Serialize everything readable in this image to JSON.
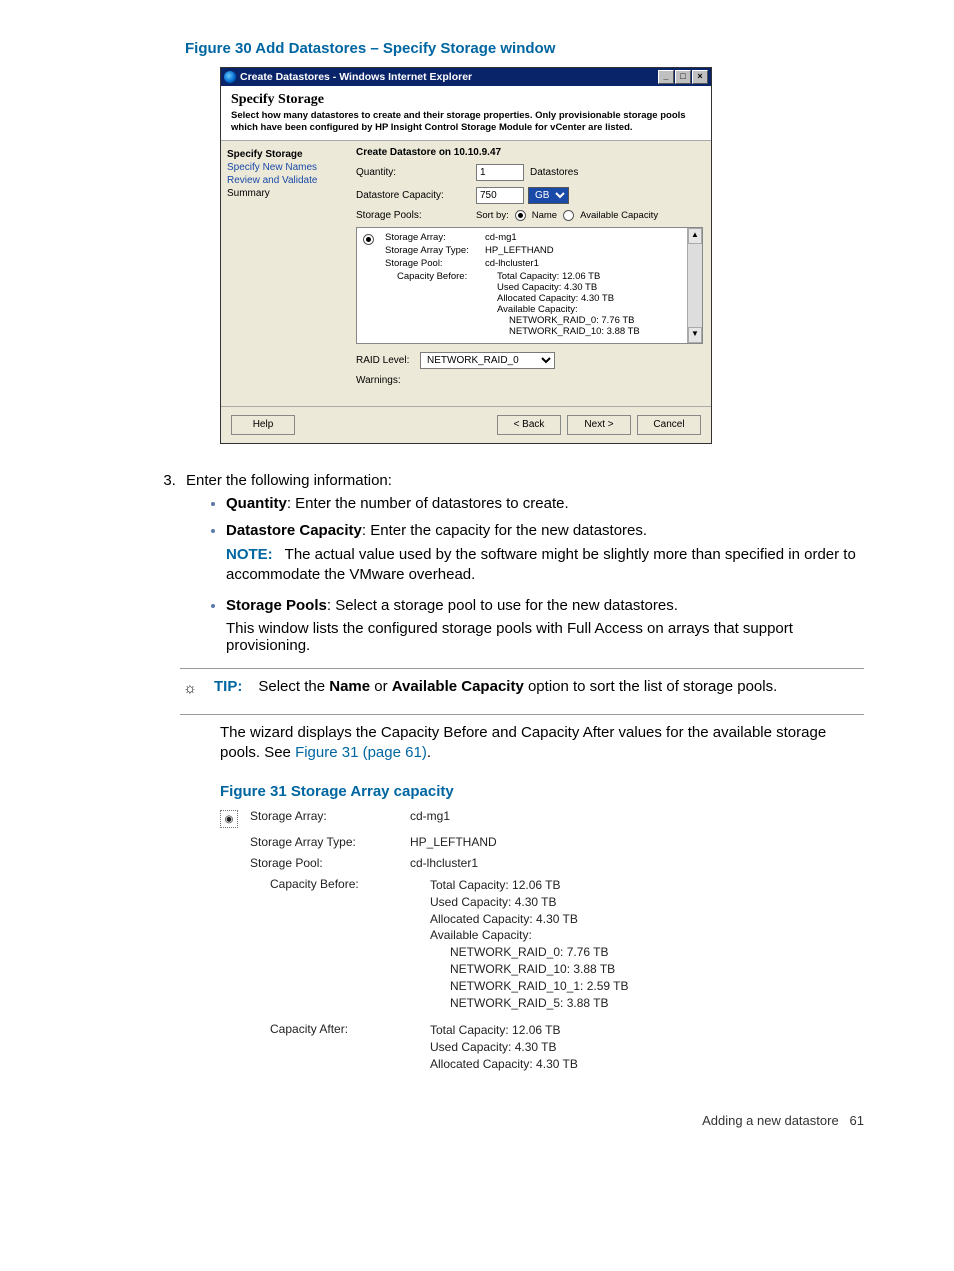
{
  "figure30": {
    "caption": "Figure 30 Add Datastores – Specify Storage window",
    "window": {
      "title": "Create Datastores - Windows Internet Explorer",
      "controls": {
        "min": "_",
        "max": "□",
        "close": "×"
      },
      "header": {
        "title": "Specify Storage",
        "desc": "Select how many datastores to create and their storage properties. Only provisionable storage pools which have been configured by HP Insight Control Storage Module for vCenter are listed."
      },
      "nav": {
        "items": [
          {
            "label": "Specify Storage",
            "state": "active"
          },
          {
            "label": "Specify New Names",
            "state": "link"
          },
          {
            "label": "Review and Validate",
            "state": "link"
          },
          {
            "label": "Summary",
            "state": "normal"
          }
        ]
      },
      "content": {
        "title": "Create Datastore on 10.10.9.47",
        "quantity_label": "Quantity:",
        "quantity_value": "1",
        "quantity_after": "Datastores",
        "capacity_label": "Datastore Capacity:",
        "capacity_value": "750",
        "capacity_unit": "GB",
        "pools_label": "Storage Pools:",
        "sortby_label": "Sort by:",
        "sortby_opts": {
          "name": "Name",
          "avail": "Available Capacity"
        },
        "pool": {
          "array_label": "Storage Array:",
          "array_value": "cd-mg1",
          "type_label": "Storage Array Type:",
          "type_value": "HP_LEFTHAND",
          "pool_label": "Storage Pool:",
          "pool_value": "cd-lhcluster1",
          "before_label": "Capacity Before:",
          "before_lines": {
            "total": "Total Capacity: 12.06 TB",
            "used": "Used Capacity: 4.30 TB",
            "alloc": "Allocated Capacity: 4.30 TB",
            "avail": "Available Capacity:",
            "r0": "NETWORK_RAID_0: 7.76 TB",
            "r10": "NETWORK_RAID_10: 3.88 TB"
          }
        },
        "raid_label": "RAID Level:",
        "raid_value": "NETWORK_RAID_0",
        "warnings_label": "Warnings:"
      },
      "footer": {
        "help": "Help",
        "back": "< Back",
        "next": "Next >",
        "cancel": "Cancel"
      }
    }
  },
  "step3": {
    "intro": "Enter the following information:",
    "quantity_label": "Quantity",
    "quantity_text": ": Enter the number of datastores to create.",
    "capacity_label": "Datastore Capacity",
    "capacity_text": ": Enter the capacity for the new datastores.",
    "note_label": "NOTE:",
    "note_text": "The actual value used by the software might be slightly more than specified in order to accommodate the VMware overhead.",
    "pools_label": "Storage Pools",
    "pools_text": ": Select a storage pool to use for the new datastores.",
    "pools_followup": "This window lists the configured storage pools with Full Access on arrays that support provisioning."
  },
  "tip": {
    "label": "TIP:",
    "text_a": "Select the ",
    "name_bold": "Name",
    "text_b": " or ",
    "avail_bold": "Available Capacity",
    "text_c": " option to sort the list of storage pools.",
    "followup_a": "The wizard displays the Capacity Before and Capacity After values for the available storage pools. See ",
    "followup_link": "Figure 31 (page 61)",
    "followup_b": "."
  },
  "figure31": {
    "caption": "Figure 31 Storage Array capacity",
    "rows": {
      "array_label": "Storage Array:",
      "array_value": "cd-mg1",
      "type_label": "Storage Array Type:",
      "type_value": "HP_LEFTHAND",
      "pool_label": "Storage Pool:",
      "pool_value": "cd-lhcluster1",
      "before_label": "Capacity Before:",
      "before": {
        "total": "Total Capacity: 12.06 TB",
        "used": "Used Capacity: 4.30 TB",
        "alloc": "Allocated Capacity: 4.30 TB",
        "avail": "Available Capacity:",
        "r0": "NETWORK_RAID_0: 7.76 TB",
        "r10": "NETWORK_RAID_10: 3.88 TB",
        "r101": "NETWORK_RAID_10_1: 2.59 TB",
        "r5": "NETWORK_RAID_5: 3.88 TB"
      },
      "after_label": "Capacity After:",
      "after": {
        "total": "Total Capacity: 12.06 TB",
        "used": "Used Capacity: 4.30 TB",
        "alloc": "Allocated Capacity: 4.30 TB"
      }
    }
  },
  "footer": {
    "section": "Adding a new datastore",
    "page": "61"
  }
}
